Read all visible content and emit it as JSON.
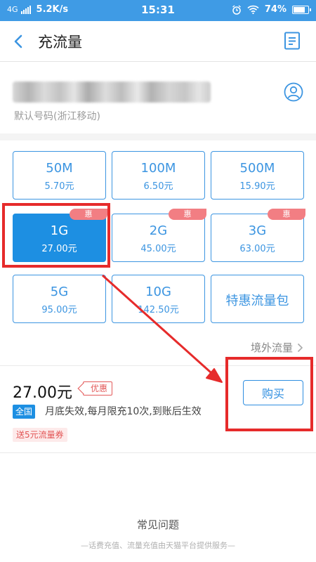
{
  "status_bar": {
    "network": "4G",
    "speed": "5.2K/s",
    "time": "15:31",
    "battery": "74%",
    "battery_level": 0.74,
    "icons": [
      "signal-icon",
      "alarm-icon",
      "wifi-icon",
      "battery-icon"
    ]
  },
  "header": {
    "title": "充流量",
    "back_icon": "chevron-left-icon",
    "record_icon": "document-list-icon"
  },
  "phone": {
    "operator_label": "默认号码(浙江移动)",
    "contact_icon": "contact-person-icon"
  },
  "plans": [
    {
      "size": "50M",
      "price": "5.70元"
    },
    {
      "size": "100M",
      "price": "6.50元"
    },
    {
      "size": "500M",
      "price": "15.90元"
    },
    {
      "size": "1G",
      "price": "27.00元",
      "badge": "惠",
      "selected": true
    },
    {
      "size": "2G",
      "price": "45.00元",
      "badge": "惠"
    },
    {
      "size": "3G",
      "price": "63.00元",
      "badge": "惠"
    },
    {
      "size": "5G",
      "price": "95.00元"
    },
    {
      "size": "10G",
      "price": "142.50元"
    },
    {
      "name": "特惠流量包"
    }
  ],
  "abroad_link": "境外流量",
  "purchase": {
    "price": "27.00元",
    "discount_tag": "优惠",
    "region": "全国",
    "rules": "月底失效,每月限充10次,到账后生效",
    "coupon": "送5元流量券",
    "buy_label": "购买"
  },
  "footer": {
    "faq": "常见问题",
    "note": "—话费充值、流量充值由天猫平台提供服务—"
  },
  "colors": {
    "status_bar": "#3f9be5",
    "accent": "#3c95e1",
    "selected": "#1d8fe2",
    "badge": "#f27e83",
    "annotation": "#e62b2b"
  }
}
